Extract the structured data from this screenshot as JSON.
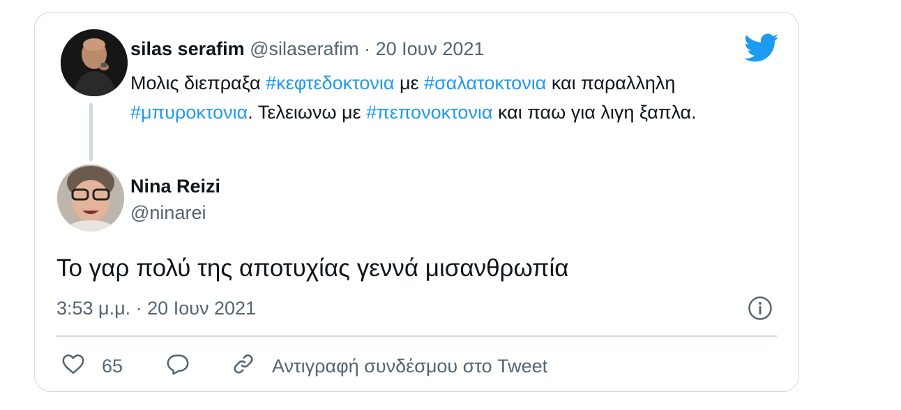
{
  "quoted_tweet": {
    "name": "silas serafim",
    "handle": "@silaserafim",
    "separator": "·",
    "date": "20 Ιουν 2021",
    "text_parts": [
      {
        "text": "Μολις διεπραξα ",
        "type": "text"
      },
      {
        "text": "#κεφτεδοκτονια",
        "type": "hashtag"
      },
      {
        "text": " με ",
        "type": "text"
      },
      {
        "text": "#σαλατοκτονια",
        "type": "hashtag"
      },
      {
        "text": " και παραλληλη ",
        "type": "text"
      },
      {
        "text": "#μπυροκτονια",
        "type": "hashtag"
      },
      {
        "text": ". Τελειωνω με ",
        "type": "text"
      },
      {
        "text": "#πεπονοκτονια",
        "type": "hashtag"
      },
      {
        "text": " και παω για λιγη ξαπλα.",
        "type": "text"
      }
    ]
  },
  "tweet": {
    "name": "Nina Reizi",
    "handle": "@ninarei",
    "text": "Το γαρ πολύ της αποτυχίας γεννά μισανθρωπία",
    "timestamp": "3:53 μ.μ. · 20 Ιουν 2021"
  },
  "actions": {
    "like_count": "65",
    "copy_link_label": "Αντιγραφή συνδέσμου στο Tweet"
  },
  "icons": {
    "brand": "twitter-bird-icon",
    "info": "info-icon",
    "like": "heart-icon",
    "reply": "reply-bubble-icon",
    "link": "link-icon"
  },
  "colors": {
    "brand_blue": "#1d9bf0",
    "text": "#0f1419",
    "muted": "#536471",
    "border": "#cfd9de"
  }
}
